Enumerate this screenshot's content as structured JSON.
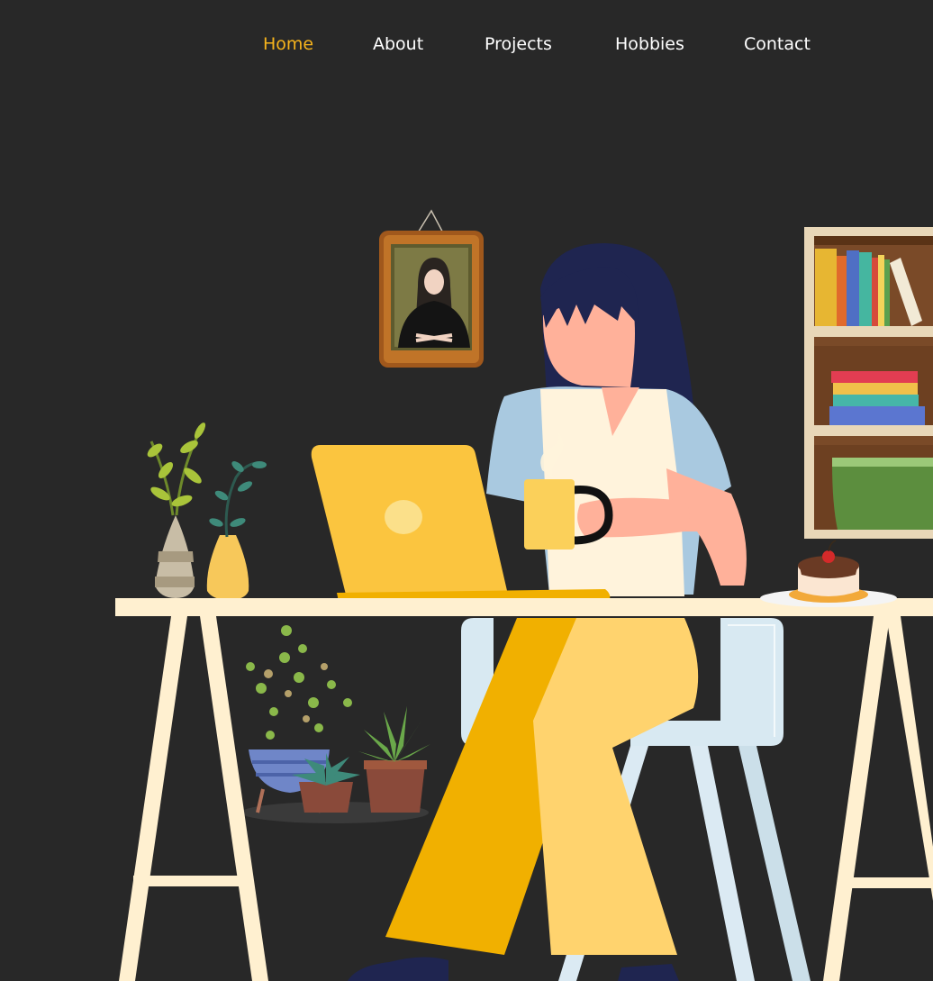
{
  "nav": {
    "items": [
      {
        "label": "Home",
        "active": true
      },
      {
        "label": "About",
        "active": false
      },
      {
        "label": "Projects",
        "active": false
      },
      {
        "label": "Hobbies",
        "active": false
      },
      {
        "label": "Contact",
        "active": false
      }
    ]
  },
  "colors": {
    "background": "#282828",
    "accent": "#f6b31c",
    "nav_text": "#ffffff"
  },
  "illustration": {
    "subject": "woman-working-at-laptop-desk-with-coffee",
    "elements": [
      "framed-portrait",
      "bookshelf",
      "laptop",
      "coffee-mug",
      "desk",
      "chair",
      "plants",
      "vases",
      "cake"
    ]
  }
}
